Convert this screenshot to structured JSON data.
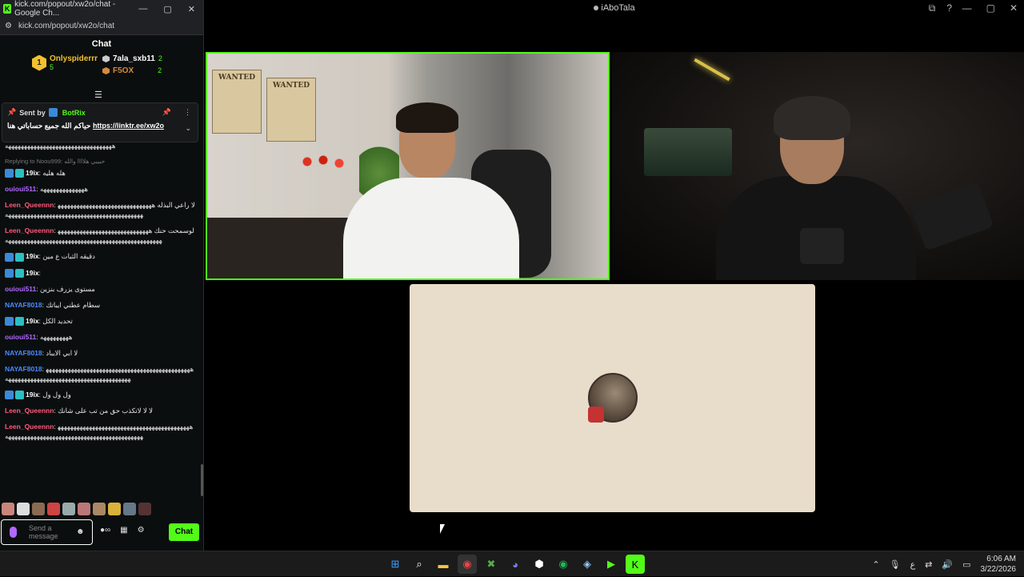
{
  "stream_window": {
    "title": "iAboTala",
    "controls": [
      "—",
      "▢",
      "✕"
    ]
  },
  "chat_window": {
    "title": "kick.com/popout/xw2o/chat - Google Ch...",
    "url": "kick.com/popout/xw2o/chat",
    "heading": "Chat",
    "controls": [
      "—",
      "▢",
      "✕"
    ]
  },
  "leaderboard": {
    "first": {
      "rank": "1",
      "name": "Onlyspiderrr",
      "count": "5"
    },
    "second": {
      "name": "7ala_sxb11",
      "count": "2"
    },
    "third": {
      "name": "F5OX",
      "count": "2"
    }
  },
  "pinned": {
    "sent_by_label": "Sent by",
    "bot_name": "BotRix",
    "message_prefix": "حياكم الله جميع حساباتي هنا",
    "link": "https://linktr.ee/xw2o"
  },
  "messages": [
    {
      "user": "",
      "text": "ههههههههههههههههههههههههههههههههههه",
      "color": "white"
    },
    {
      "reply": "Replying to Noou999: حبيبي هلاااا والله",
      "user": "19ix",
      "text": "هله هليه",
      "color": "white",
      "badges": true
    },
    {
      "user": "ouioui511",
      "text": "ههههههههههههههه",
      "color": "purple"
    },
    {
      "user": "Leen_Queennn",
      "text": "لا راعي البذله ههههههههههههههههههههههههههههههههههههههههههههههههههههههههههههههههههههههههههه",
      "color": "red"
    },
    {
      "user": "Leen_Queennn",
      "text": "لوسمحت حنك هههههههههههههههههههههههههههههههههههههههههههههههههههههههههههههههههههههههههههههههه",
      "color": "red"
    },
    {
      "user": "19ix",
      "text": "دقيقه الثبات ع مين",
      "color": "white",
      "badges": true
    },
    {
      "user": "19ix",
      "text": "",
      "color": "white",
      "badges": true
    },
    {
      "user": "ouioui511",
      "text": "مستوى يزرف بنزين",
      "color": "purple"
    },
    {
      "user": "NAYAF8018",
      "text": "سطام عطني ايباتك",
      "color": "blue"
    },
    {
      "user": "19ix",
      "text": "تحديد الكل",
      "color": "white",
      "badges": true
    },
    {
      "user": "ouioui511",
      "text": "هههههههههه",
      "color": "purple"
    },
    {
      "user": "NAYAF8018",
      "text": "لا ابي الايباد",
      "color": "blue"
    },
    {
      "user": "NAYAF8018",
      "text": "ههههههههههههههههههههههههههههههههههههههههههههههههههههههههههههههههههههههههههههههههههههههه",
      "color": "blue"
    },
    {
      "user": "19ix",
      "text": "ول ول ول",
      "color": "white",
      "badges": true
    },
    {
      "user": "Leen_Queennn",
      "text": "لا لا لاتكذب حق من تب على شانك",
      "color": "red"
    },
    {
      "user": "Leen_Queennn",
      "text": "ههههههههههههههههههههههههههههههههههههههههههههههههههههههههههههههههههههههههههههههههههههههه",
      "color": "red"
    }
  ],
  "composer": {
    "placeholder": "Send a message",
    "send_label": "Chat"
  },
  "taskbar": {
    "time": "6:06 AM",
    "date": "3/22/2026",
    "lang": "ع"
  },
  "colors": {
    "kick_green": "#53fc18",
    "user_red": "#ff5a7a",
    "user_purple": "#b068ff",
    "user_blue": "#4a8bff"
  }
}
